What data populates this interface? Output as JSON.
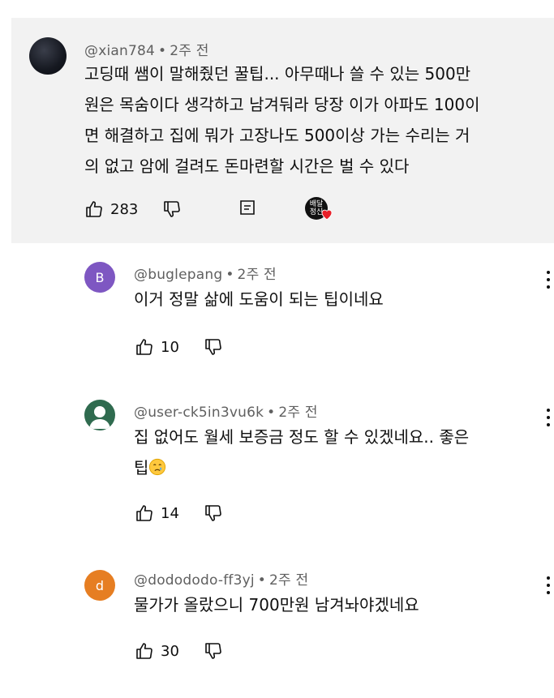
{
  "comments": [
    {
      "author": "@xian784",
      "time": "2주 전",
      "lines": [
        "고딩때 쌤이 말해줬던 꿀팁... 아무때나 쓸 수 있는 500만",
        "원은 목숨이다 생각하고 남겨둬라 당장 이가 아파도 100이",
        "면 해결하고 집에 뭐가 고장나도 500이상 가는 수리는 거",
        "의 없고 암에 걸려도 돈마련할 시간은 벌 수 있다"
      ],
      "likes": "283",
      "creator_avatar_text": "배달\n정신"
    },
    {
      "author": "@buglepang",
      "time": "2주 전",
      "avatar_letter": "B",
      "avatar_color": "#7e57c2",
      "lines": [
        "이거 정말 삶에 도움이 되는 팁이네요"
      ],
      "likes": "10"
    },
    {
      "author": "@user-ck5in3vu6k",
      "time": "2주 전",
      "avatar_color": "#2f6b4f",
      "lines": [
        "집 없어도 월세 보증금 정도 할 수 있겠네요.. 좋은",
        "팁"
      ],
      "likes": "14"
    },
    {
      "author": "@dodododo-ff3yj",
      "time": "2주 전",
      "avatar_letter": "d",
      "avatar_color": "#e67e22",
      "lines": [
        "물가가 올랐으니 700만원 남겨놔야겠네요"
      ],
      "likes": "30"
    }
  ],
  "separator": "•",
  "icons": [
    "like-icon",
    "dislike-icon",
    "reply-icon",
    "more-vert-icon",
    "heart-icon",
    "crying-emoji"
  ]
}
